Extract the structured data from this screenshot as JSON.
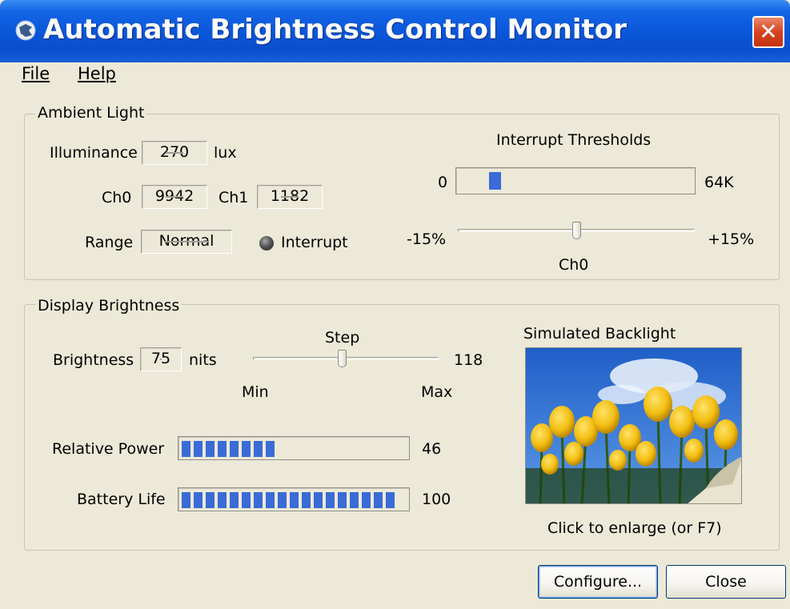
{
  "window": {
    "title": "Automatic Brightness Control Monitor",
    "close_glyph": "✕",
    "icon": "app-globe-icon"
  },
  "menu": {
    "file": "File",
    "help": "Help"
  },
  "ambient": {
    "legend": "Ambient Light",
    "illuminance_label": "Illuminance",
    "illuminance_value": "270",
    "illuminance_unit": "lux",
    "ch0_label": "Ch0",
    "ch0_value": "9942",
    "ch1_label": "Ch1",
    "ch1_value": "1182",
    "range_label": "Range",
    "range_value": "Normal",
    "interrupt_label": "Interrupt",
    "thresholds_title": "Interrupt Thresholds",
    "threshold_min": "0",
    "threshold_max": "64K",
    "threshold_level": 0.09,
    "pct_min": "-15%",
    "pct_max": "+15%",
    "pct_slider_value": 0.5,
    "pct_slider_label": "Ch0"
  },
  "display": {
    "legend": "Display Brightness",
    "brightness_label": "Brightness",
    "brightness_value": "75",
    "brightness_unit": "nits",
    "step_label": "Step",
    "step_max_value": "118",
    "slider_min": "Min",
    "slider_max": "Max",
    "slider_value": 0.48,
    "relative_power_label": "Relative Power",
    "relative_power_value": "46",
    "relative_power_level": 0.46,
    "battery_label": "Battery Life",
    "battery_value": "100",
    "battery_level": 1.0,
    "backlight_title": "Simulated Backlight",
    "backlight_caption": "Click to enlarge (or F7)"
  },
  "buttons": {
    "configure": "Configure...",
    "close": "Close"
  },
  "colors": {
    "titlebar": "#0a55d8",
    "window_bg": "#ece9d8",
    "progress_fill": "#3a6bd6",
    "close_button": "#d8431f"
  }
}
